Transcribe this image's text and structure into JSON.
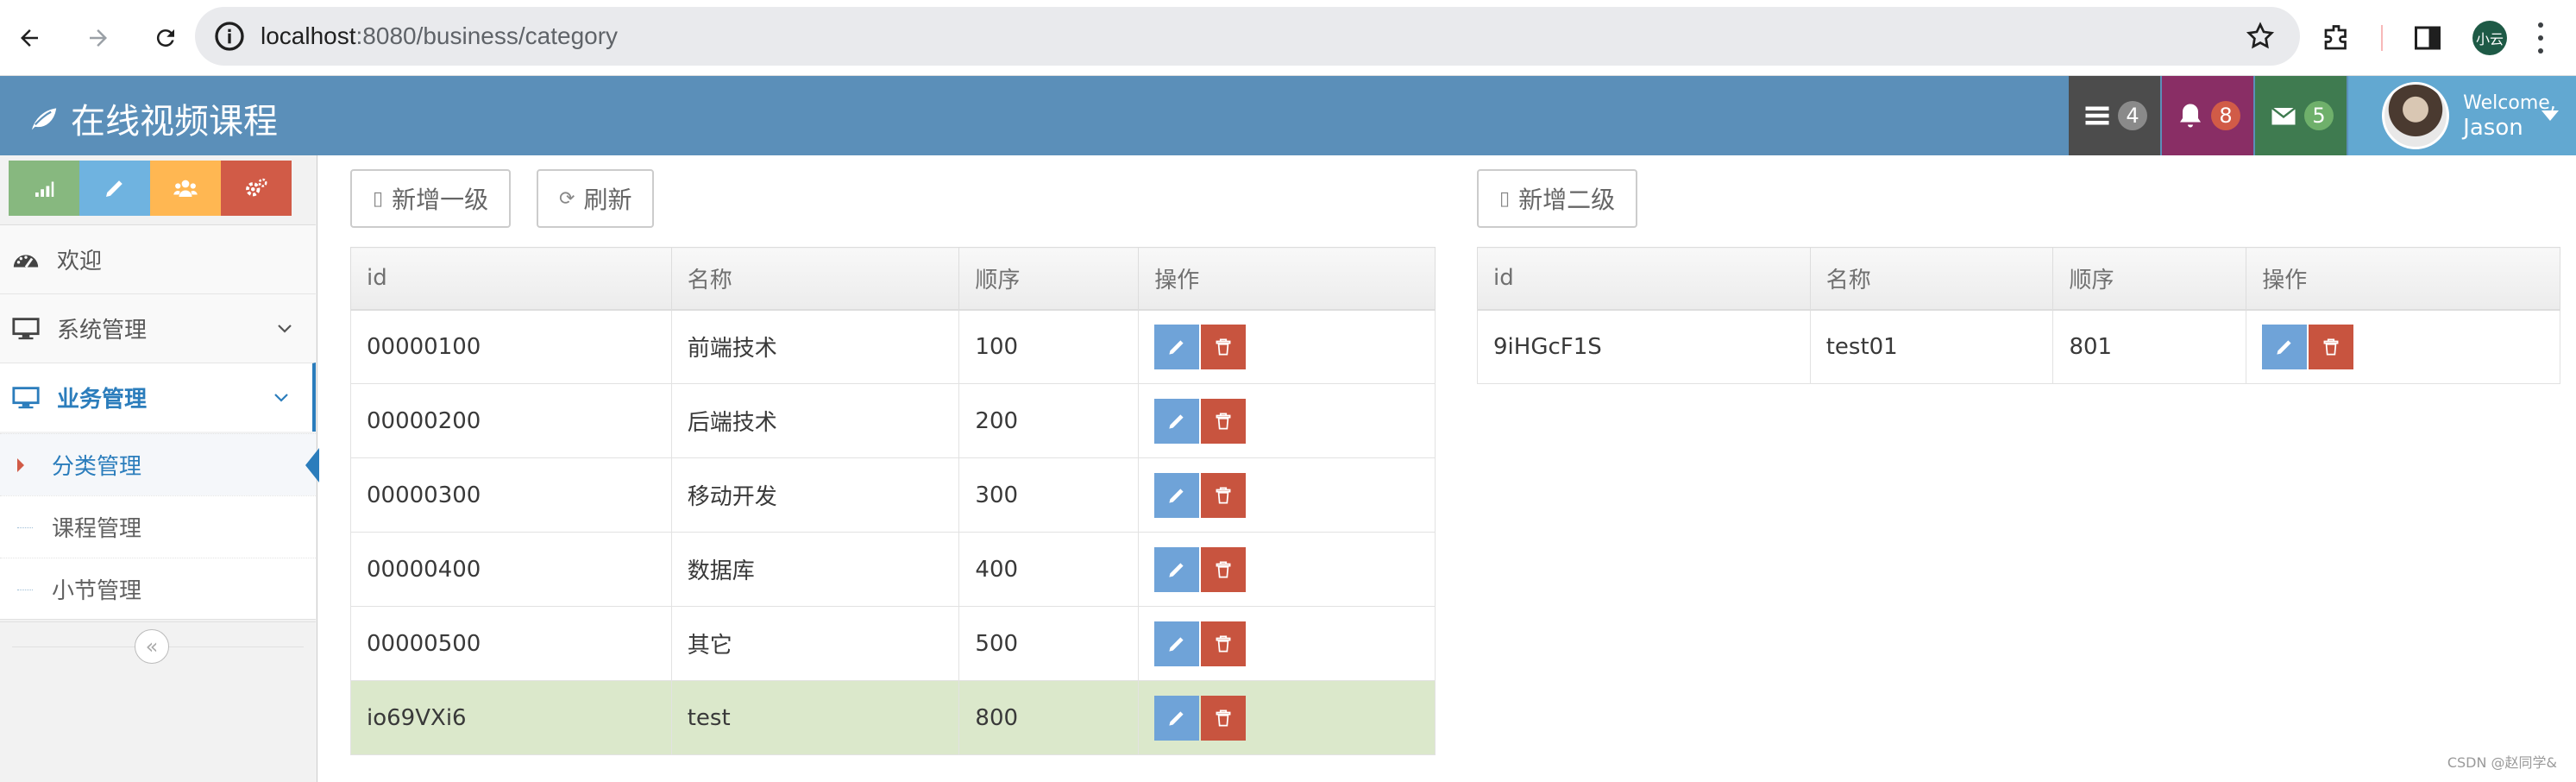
{
  "browser": {
    "url_host": "localhost",
    "url_path": ":8080/business/category",
    "profile_label": "小云"
  },
  "navbar": {
    "brand": "在线视频课程",
    "tasks_count": "4",
    "notifications_count": "8",
    "messages_count": "5",
    "welcome": "Welcome,",
    "username": "Jason"
  },
  "sidebar": {
    "items": [
      {
        "label": "欢迎"
      },
      {
        "label": "系统管理"
      },
      {
        "label": "业务管理"
      }
    ],
    "subitems": [
      {
        "label": "分类管理"
      },
      {
        "label": "课程管理"
      },
      {
        "label": "小节管理"
      }
    ]
  },
  "toolbar": {
    "add_level1": "新增一级",
    "refresh": "刷新",
    "add_level2": "新增二级"
  },
  "level1_table": {
    "headers": [
      "id",
      "名称",
      "顺序",
      "操作"
    ],
    "rows": [
      {
        "id": "00000100",
        "name": "前端技术",
        "sort": "100"
      },
      {
        "id": "00000200",
        "name": "后端技术",
        "sort": "200"
      },
      {
        "id": "00000300",
        "name": "移动开发",
        "sort": "300"
      },
      {
        "id": "00000400",
        "name": "数据库",
        "sort": "400"
      },
      {
        "id": "00000500",
        "name": "其它",
        "sort": "500"
      },
      {
        "id": "io69VXi6",
        "name": "test",
        "sort": "800"
      }
    ]
  },
  "level2_table": {
    "headers": [
      "id",
      "名称",
      "顺序",
      "操作"
    ],
    "rows": [
      {
        "id": "9iHGcF1S",
        "name": "test01",
        "sort": "801"
      }
    ]
  },
  "watermark": "CSDN @赵同学&",
  "colors": {
    "navbar": "#5b8fb9",
    "highlight_row": "#dbe8cb",
    "edit_button": "#6fa3d8",
    "delete_button": "#c8543f"
  }
}
